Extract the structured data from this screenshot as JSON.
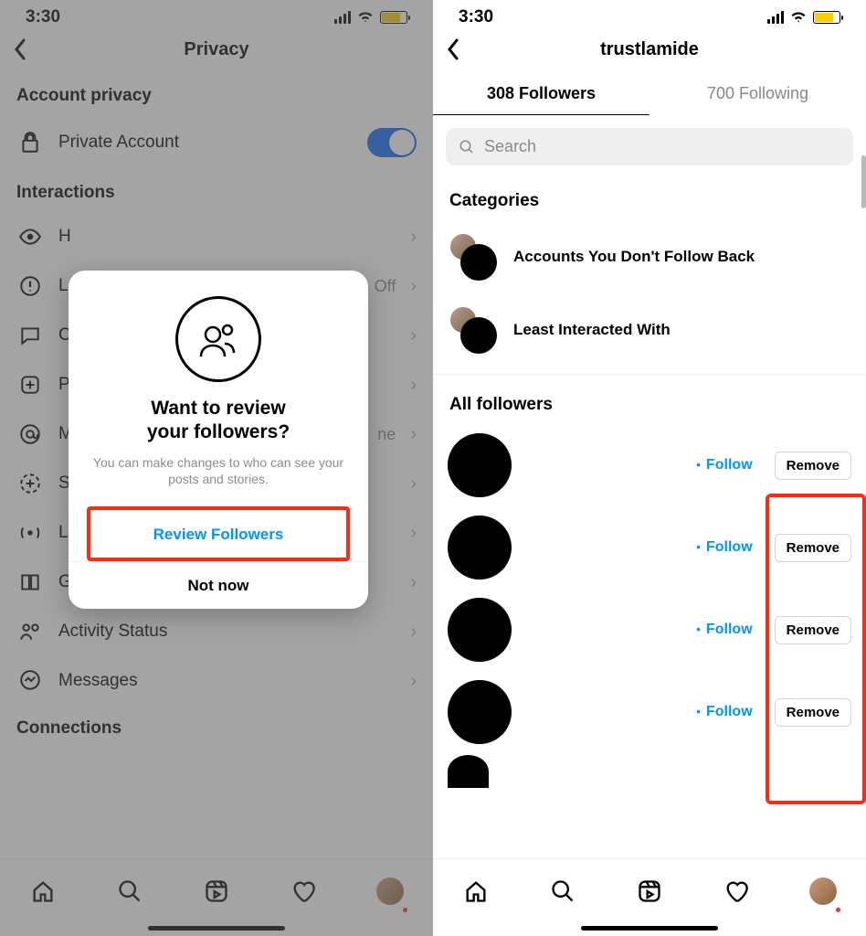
{
  "status": {
    "time": "3:30"
  },
  "left": {
    "title": "Privacy",
    "section_account": "Account privacy",
    "private_account": "Private Account",
    "section_interactions": "Interactions",
    "section_connections": "Connections",
    "items": [
      {
        "label": "H"
      },
      {
        "label": "L",
        "value": "Off"
      },
      {
        "label": "C"
      },
      {
        "label": "P"
      },
      {
        "label": "M",
        "value": "ne"
      },
      {
        "label": "S"
      },
      {
        "label": "L"
      },
      {
        "label": "G"
      }
    ],
    "activity_status": "Activity Status",
    "messages": "Messages",
    "modal": {
      "title1": "Want to review",
      "title2": "your followers?",
      "subtitle": "You can make changes to who can see your posts and stories.",
      "primary": "Review Followers",
      "secondary": "Not now"
    }
  },
  "right": {
    "title": "trustlamide",
    "followers_count": "308",
    "followers_label": "Followers",
    "following_count": "700",
    "following_label": "Following",
    "search_placeholder": "Search",
    "categories_label": "Categories",
    "category1": "Accounts You Don't Follow Back",
    "category2": "Least Interacted With",
    "all_followers": "All followers",
    "follow_label": "Follow",
    "remove_label": "Remove"
  }
}
